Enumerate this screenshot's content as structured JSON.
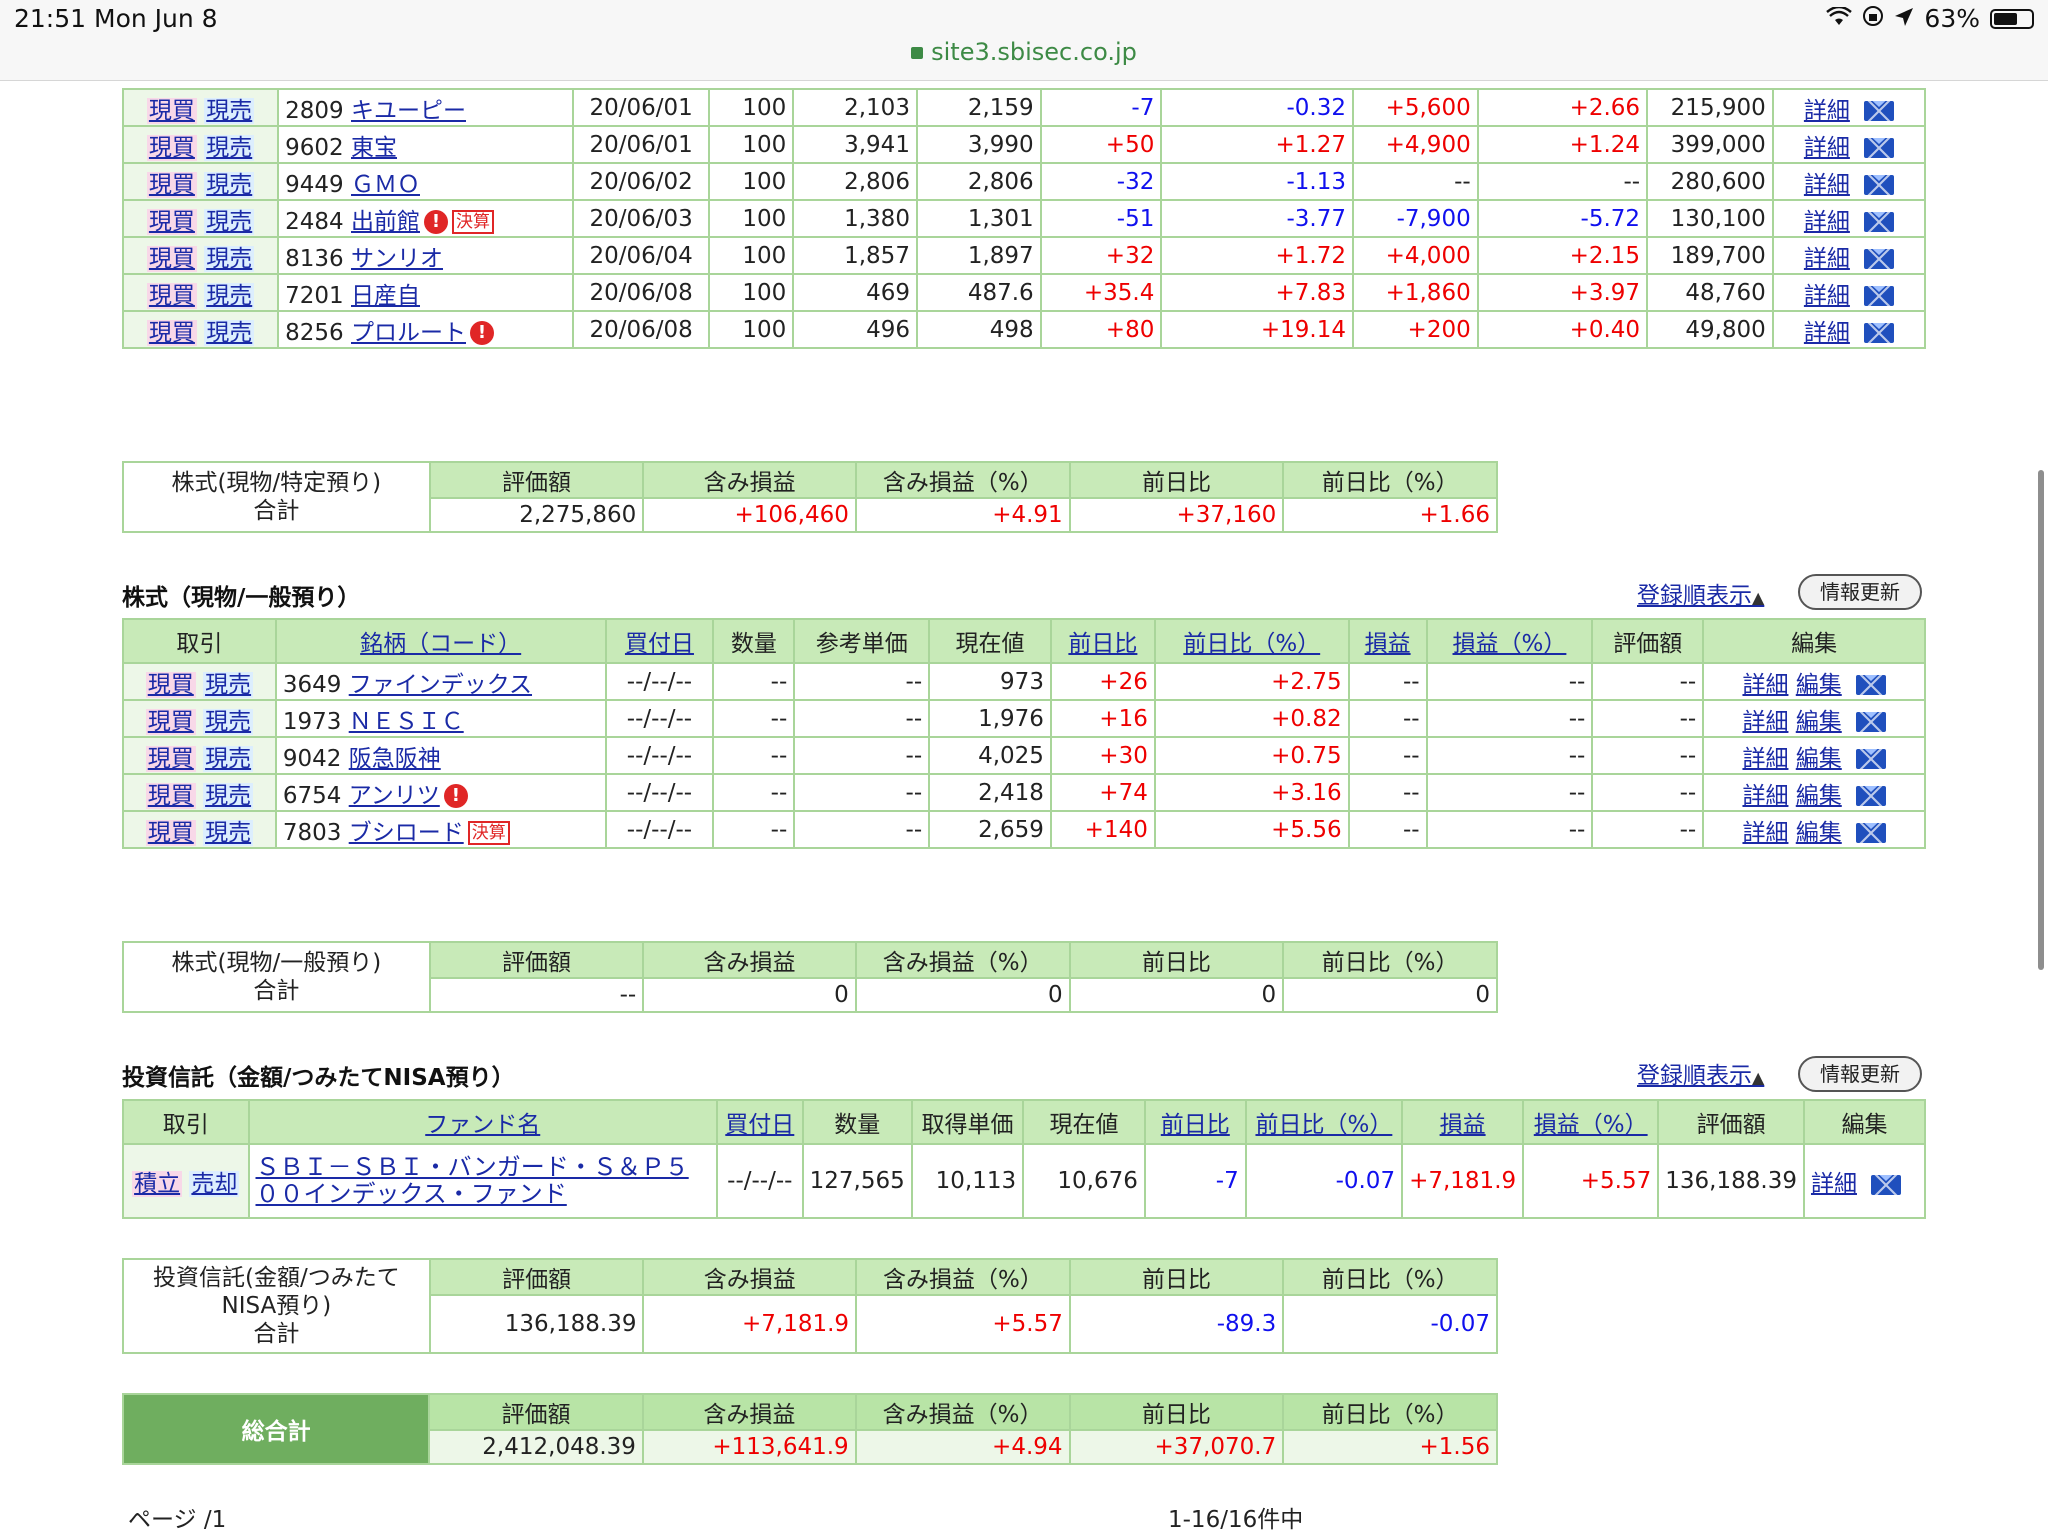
{
  "status": {
    "time": "21:51",
    "date": "Mon Jun 8",
    "battery": "63%",
    "battery_level": 0.63,
    "url": "site3.sbisec.co.jp"
  },
  "common": {
    "buy": "現買",
    "sell": "現売",
    "detail": "詳細",
    "edit": "編集",
    "warn": "!",
    "kessan": "決算"
  },
  "top_rows": [
    {
      "code": "2809",
      "name": "キユーピー",
      "date": "20/06/01",
      "qty": "100",
      "ref": "2,103",
      "now": "2,159",
      "chg": "-7",
      "chgp": "-0.32",
      "pl": "+5,600",
      "plp": "+2.66",
      "val": "215,900",
      "badges": []
    },
    {
      "code": "9602",
      "name": "東宝",
      "date": "20/06/01",
      "qty": "100",
      "ref": "3,941",
      "now": "3,990",
      "chg": "+50",
      "chgp": "+1.27",
      "pl": "+4,900",
      "plp": "+1.24",
      "val": "399,000",
      "badges": []
    },
    {
      "code": "9449",
      "name": "ＧＭＯ",
      "date": "20/06/02",
      "qty": "100",
      "ref": "2,806",
      "now": "2,806",
      "chg": "-32",
      "chgp": "-1.13",
      "pl": "--",
      "plp": "--",
      "val": "280,600",
      "badges": []
    },
    {
      "code": "2484",
      "name": "出前館",
      "date": "20/06/03",
      "qty": "100",
      "ref": "1,380",
      "now": "1,301",
      "chg": "-51",
      "chgp": "-3.77",
      "pl": "-7,900",
      "plp": "-5.72",
      "val": "130,100",
      "badges": [
        "warn",
        "kessan"
      ]
    },
    {
      "code": "8136",
      "name": "サンリオ",
      "date": "20/06/04",
      "qty": "100",
      "ref": "1,857",
      "now": "1,897",
      "chg": "+32",
      "chgp": "+1.72",
      "pl": "+4,000",
      "plp": "+2.15",
      "val": "189,700",
      "badges": []
    },
    {
      "code": "7201",
      "name": "日産自",
      "date": "20/06/08",
      "qty": "100",
      "ref": "469",
      "now": "487.6",
      "chg": "+35.4",
      "chgp": "+7.83",
      "pl": "+1,860",
      "plp": "+3.97",
      "val": "48,760",
      "badges": []
    },
    {
      "code": "8256",
      "name": "プロルート",
      "date": "20/06/08",
      "qty": "100",
      "ref": "496",
      "now": "498",
      "chg": "+80",
      "chgp": "+19.14",
      "pl": "+200",
      "plp": "+0.40",
      "val": "49,800",
      "badges": [
        "warn"
      ]
    }
  ],
  "summary_headers": [
    "評価額",
    "含み損益",
    "含み損益（%）",
    "前日比",
    "前日比（%）"
  ],
  "summary1": {
    "label1": "株式(現物/特定預り)",
    "label2": "合計",
    "values": [
      "2,275,860",
      "+106,460",
      "+4.91",
      "+37,160",
      "+1.66"
    ]
  },
  "section2": {
    "title": "株式（現物/一般預り）",
    "sort": "登録順表示",
    "refresh": "情報更新",
    "headers": [
      "取引",
      "銘柄（コード）",
      "買付日",
      "数量",
      "参考単価",
      "現在値",
      "前日比",
      "前日比（%）",
      "損益",
      "損益（%）",
      "評価額",
      "編集"
    ],
    "rows": [
      {
        "code": "3649",
        "name": "ファインデックス",
        "date": "--/--/--",
        "qty": "--",
        "ref": "--",
        "now": "973",
        "chg": "+26",
        "chgp": "+2.75",
        "pl": "--",
        "plp": "--",
        "val": "--",
        "badges": []
      },
      {
        "code": "1973",
        "name": "ＮＥＳＩＣ",
        "date": "--/--/--",
        "qty": "--",
        "ref": "--",
        "now": "1,976",
        "chg": "+16",
        "chgp": "+0.82",
        "pl": "--",
        "plp": "--",
        "val": "--",
        "badges": []
      },
      {
        "code": "9042",
        "name": "阪急阪神",
        "date": "--/--/--",
        "qty": "--",
        "ref": "--",
        "now": "4,025",
        "chg": "+30",
        "chgp": "+0.75",
        "pl": "--",
        "plp": "--",
        "val": "--",
        "badges": []
      },
      {
        "code": "6754",
        "name": "アンリツ",
        "date": "--/--/--",
        "qty": "--",
        "ref": "--",
        "now": "2,418",
        "chg": "+74",
        "chgp": "+3.16",
        "pl": "--",
        "plp": "--",
        "val": "--",
        "badges": [
          "warn"
        ]
      },
      {
        "code": "7803",
        "name": "ブシロード",
        "date": "--/--/--",
        "qty": "--",
        "ref": "--",
        "now": "2,659",
        "chg": "+140",
        "chgp": "+5.56",
        "pl": "--",
        "plp": "--",
        "val": "--",
        "badges": [
          "kessan"
        ]
      }
    ]
  },
  "summary2": {
    "label1": "株式(現物/一般預り)",
    "label2": "合計",
    "values": [
      "--",
      "0",
      "0",
      "0",
      "0"
    ]
  },
  "section3": {
    "title": "投資信託（金額/つみたてNISA預り）",
    "sort": "登録順表示",
    "refresh": "情報更新",
    "headers": [
      "取引",
      "ファンド名",
      "買付日",
      "数量",
      "取得単価",
      "現在値",
      "前日比",
      "前日比（%）",
      "損益",
      "損益（%）",
      "評価額",
      "編集"
    ],
    "row": {
      "act1": "積立",
      "act2": "売却",
      "name1": "ＳＢＩ－ＳＢＩ・バンガード・Ｓ＆Ｐ５",
      "name2": "００インデックス・ファンド",
      "date": "--/--/--",
      "qty": "127,565",
      "cost": "10,113",
      "now": "10,676",
      "chg": "-7",
      "chgp": "-0.07",
      "pl": "+7,181.9",
      "plp": "+5.57",
      "val": "136,188.39"
    }
  },
  "summary3": {
    "label1": "投資信託(金額/つみたて",
    "label2": "NISA預り)",
    "label3": "合計",
    "values": [
      "136,188.39",
      "+7,181.9",
      "+5.57",
      "-89.3",
      "-0.07"
    ]
  },
  "grand": {
    "label": "総合計",
    "values": [
      "2,412,048.39",
      "+113,641.9",
      "+4.94",
      "+37,070.7",
      "+1.56"
    ]
  },
  "footer": {
    "page": "ページ /1",
    "count": "1-16/16件中"
  }
}
